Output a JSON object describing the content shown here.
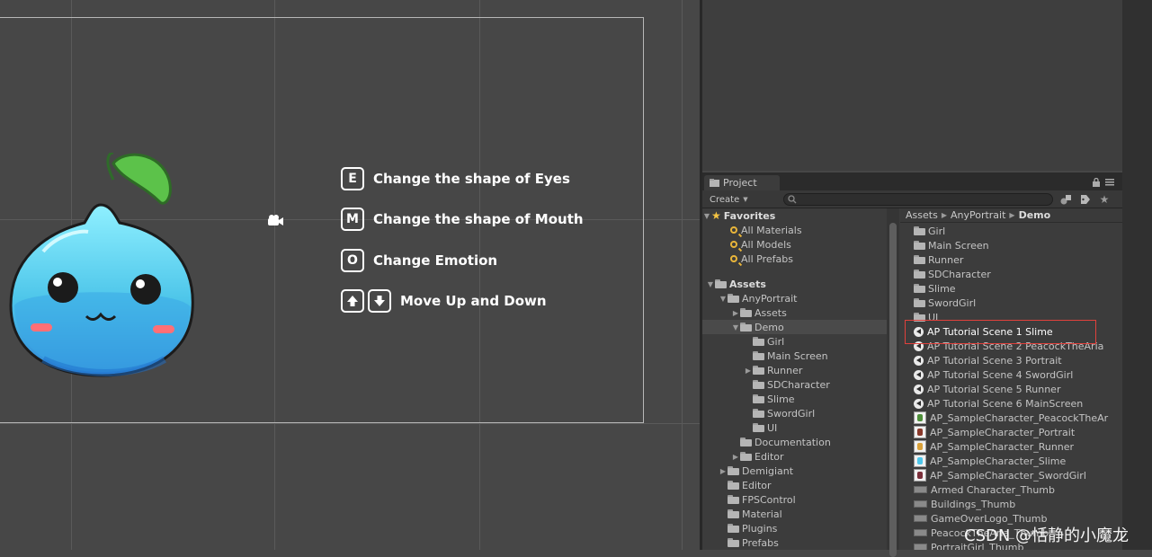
{
  "scene": {
    "instructions": [
      {
        "key": "E",
        "label": "Change the shape of Eyes"
      },
      {
        "key": "M",
        "label": "Change the shape of Mouth"
      },
      {
        "key": "O",
        "label": "Change Emotion"
      }
    ],
    "arrow_instruction": {
      "keys": [
        "arrow-up-icon",
        "arrow-down-icon"
      ],
      "label": "Move Up and Down"
    }
  },
  "project": {
    "tab_label": "Project",
    "create_label": "Create",
    "favorites": {
      "label": "Favorites",
      "items": [
        "All Materials",
        "All Models",
        "All Prefabs"
      ]
    },
    "tree": [
      {
        "label": "Assets",
        "depth": 0,
        "arrow": "open",
        "bold": true
      },
      {
        "label": "AnyPortrait",
        "depth": 1,
        "arrow": "open"
      },
      {
        "label": "Assets",
        "depth": 2,
        "arrow": "closed"
      },
      {
        "label": "Demo",
        "depth": 2,
        "arrow": "open",
        "selected": true
      },
      {
        "label": "Girl",
        "depth": 3
      },
      {
        "label": "Main Screen",
        "depth": 3
      },
      {
        "label": "Runner",
        "depth": 3,
        "arrow": "closed"
      },
      {
        "label": "SDCharacter",
        "depth": 3
      },
      {
        "label": "Slime",
        "depth": 3
      },
      {
        "label": "SwordGirl",
        "depth": 3
      },
      {
        "label": "UI",
        "depth": 3
      },
      {
        "label": "Documentation",
        "depth": 2
      },
      {
        "label": "Editor",
        "depth": 2,
        "arrow": "closed"
      },
      {
        "label": "Demigiant",
        "depth": 1,
        "arrow": "closed"
      },
      {
        "label": "Editor",
        "depth": 1
      },
      {
        "label": "FPSControl",
        "depth": 1
      },
      {
        "label": "Material",
        "depth": 1
      },
      {
        "label": "Plugins",
        "depth": 1
      },
      {
        "label": "Prefabs",
        "depth": 1
      }
    ],
    "breadcrumb": [
      "Assets",
      "AnyPortrait",
      "Demo"
    ],
    "assets": [
      {
        "label": "Girl",
        "icon": "folder"
      },
      {
        "label": "Main Screen",
        "icon": "folder"
      },
      {
        "label": "Runner",
        "icon": "folder"
      },
      {
        "label": "SDCharacter",
        "icon": "folder"
      },
      {
        "label": "Slime",
        "icon": "folder"
      },
      {
        "label": "SwordGirl",
        "icon": "folder"
      },
      {
        "label": "UI",
        "icon": "folder"
      },
      {
        "label": "AP Tutorial Scene 1 Slime",
        "icon": "unity-scene",
        "highlighted": true
      },
      {
        "label": "AP Tutorial Scene 2 PeacockTheAria",
        "icon": "unity-scene"
      },
      {
        "label": "AP Tutorial Scene 3 Portrait",
        "icon": "unity-scene"
      },
      {
        "label": "AP Tutorial Scene 4 SwordGirl",
        "icon": "unity-scene"
      },
      {
        "label": "AP Tutorial Scene 5 Runner",
        "icon": "unity-scene"
      },
      {
        "label": "AP Tutorial Scene 6 MainScreen",
        "icon": "unity-scene"
      },
      {
        "label": "AP_SampleCharacter_PeacockTheAr",
        "icon": "character-thumb",
        "color": "#4e8f3a"
      },
      {
        "label": "AP_SampleCharacter_Portrait",
        "icon": "character-thumb",
        "color": "#8a3a2c"
      },
      {
        "label": "AP_SampleCharacter_Runner",
        "icon": "character-thumb",
        "color": "#d9a13a"
      },
      {
        "label": "AP_SampleCharacter_Slime",
        "icon": "character-thumb",
        "color": "#4ec6ea"
      },
      {
        "label": "AP_SampleCharacter_SwordGirl",
        "icon": "character-thumb",
        "color": "#7a2f3a"
      },
      {
        "label": "Armed Character_Thumb",
        "icon": "image-thumb"
      },
      {
        "label": "Buildings_Thumb",
        "icon": "image-thumb"
      },
      {
        "label": "GameOverLogo_Thumb",
        "icon": "image-thumb"
      },
      {
        "label": "PeacockTheAria_Thumb",
        "icon": "image-thumb"
      },
      {
        "label": "PortraitGirl_Thumb",
        "icon": "image-thumb"
      }
    ]
  },
  "watermark": "CSDN @恬静的小魔龙",
  "colors": {
    "selection_box": "#e0413c",
    "slime_body": "#4ec6ea",
    "leaf": "#5cc24a"
  }
}
